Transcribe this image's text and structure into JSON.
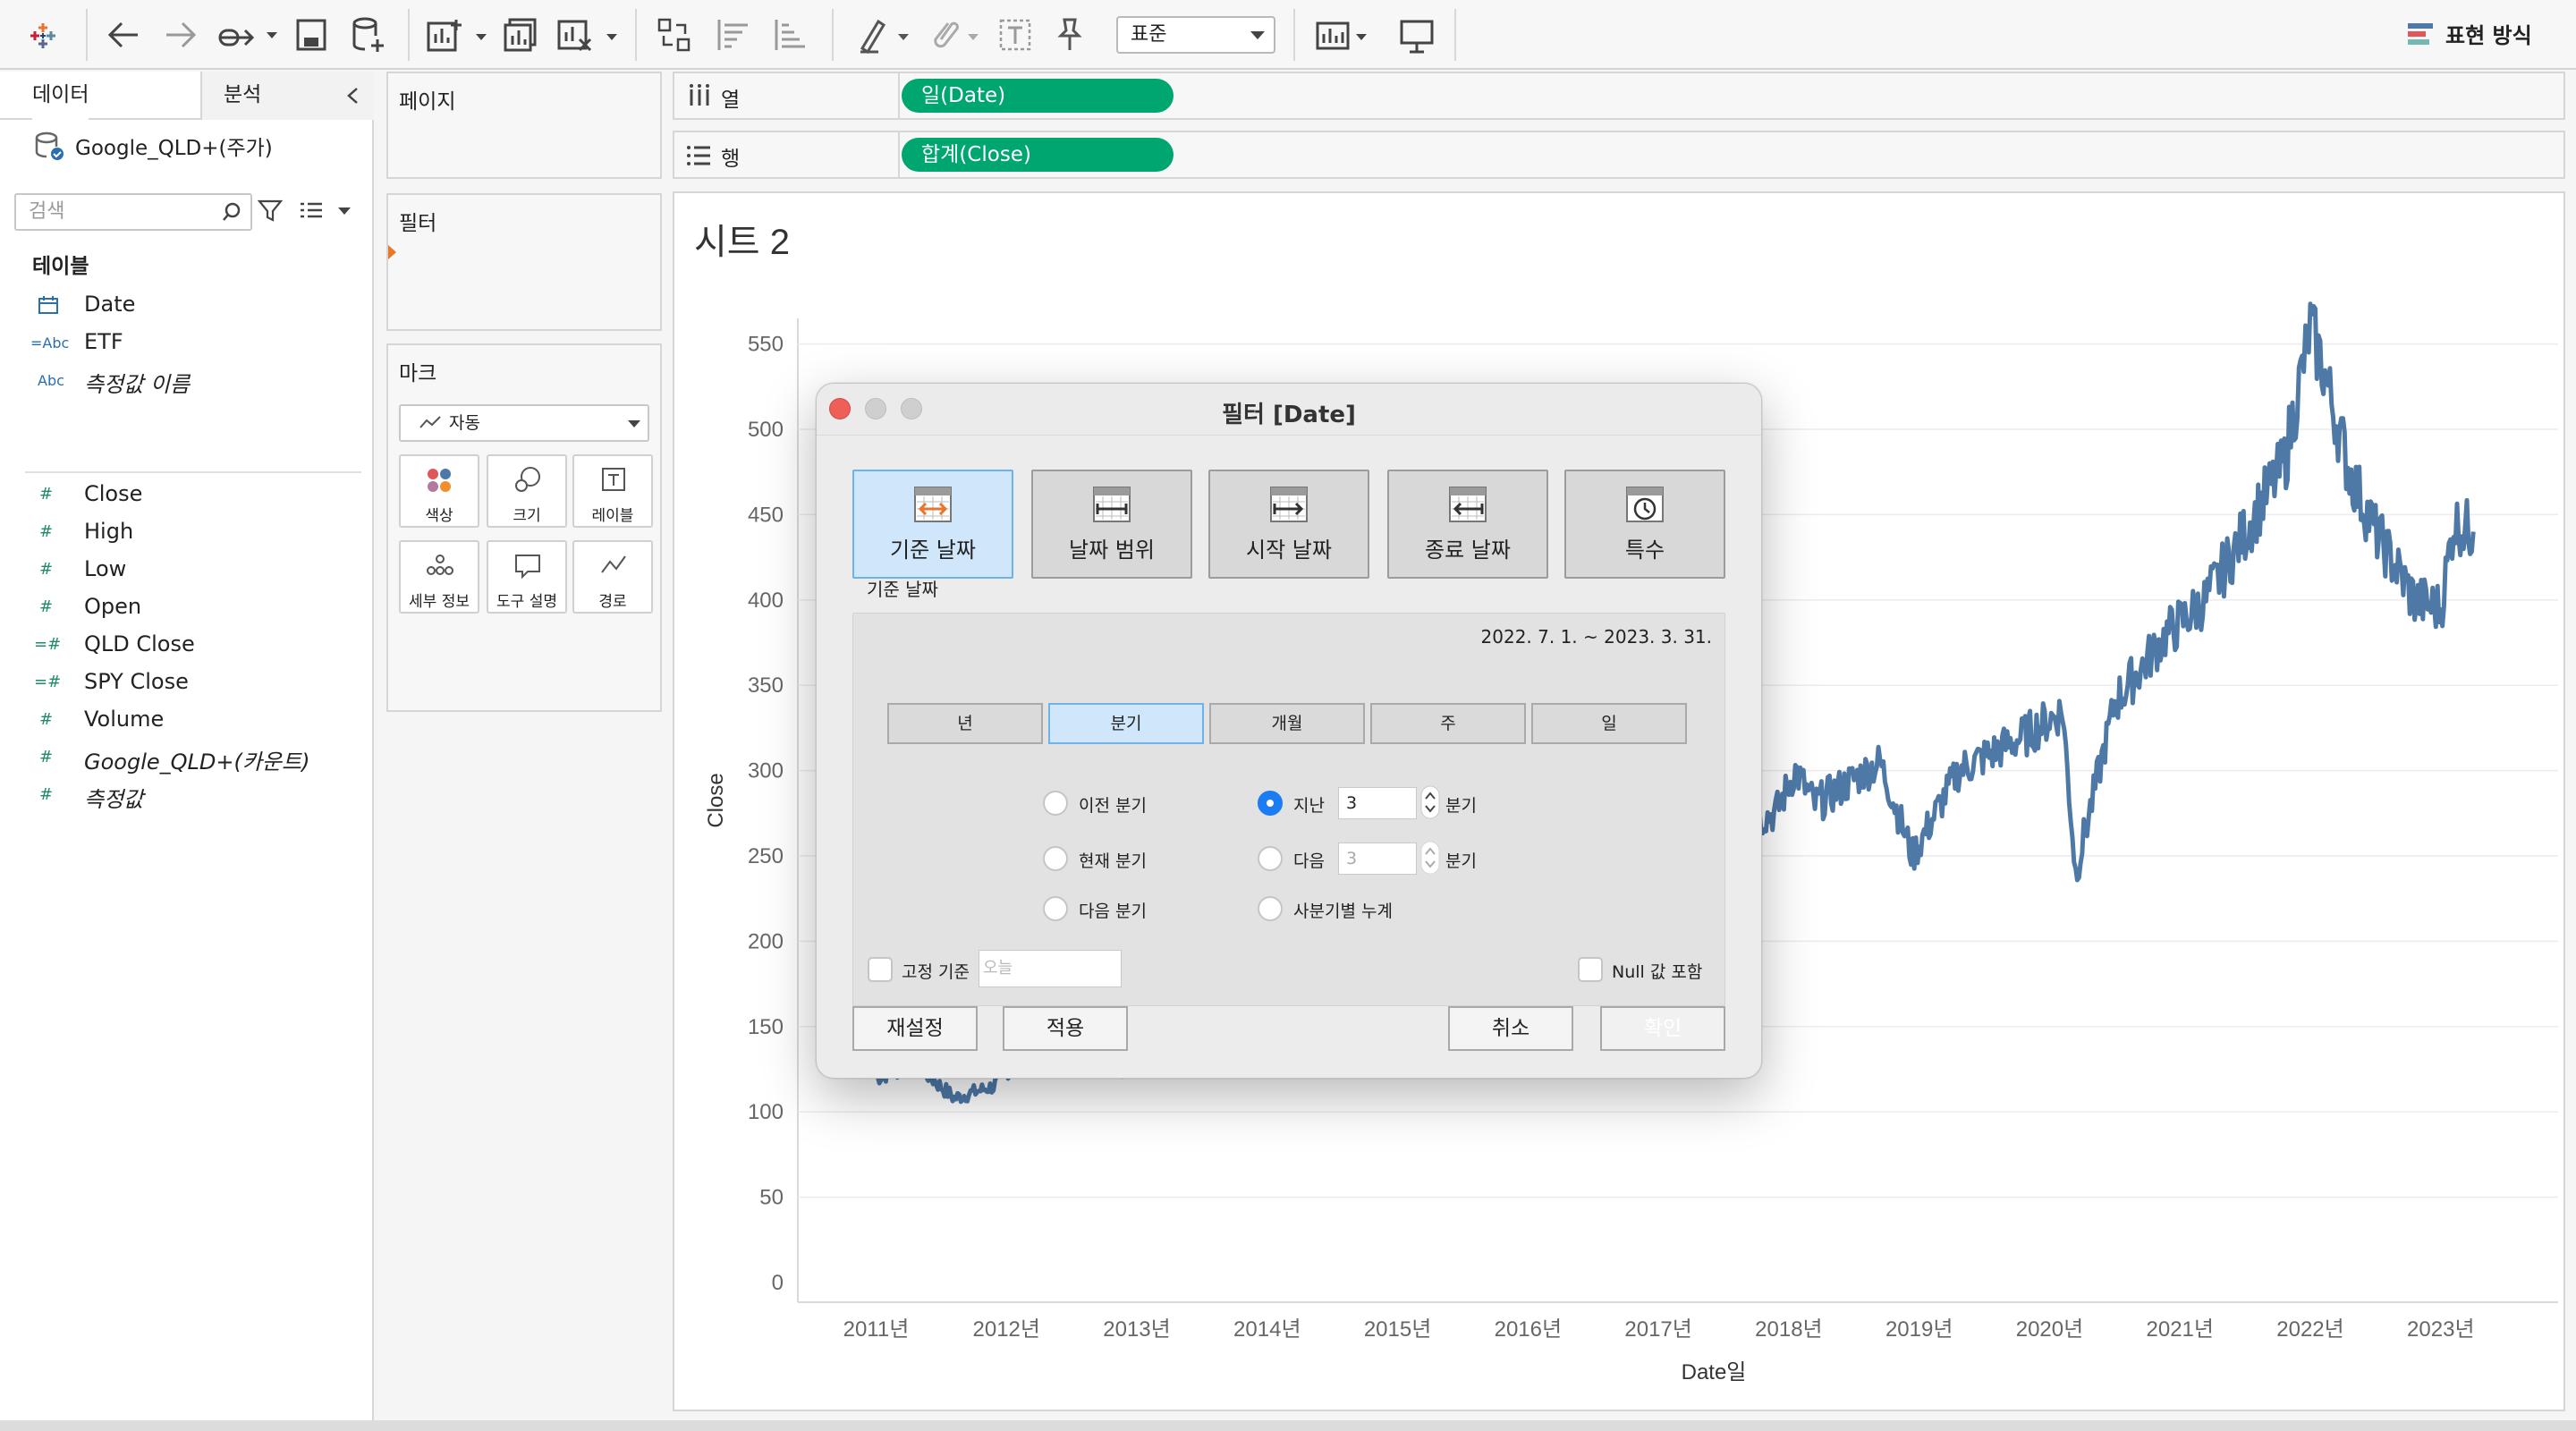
{
  "toolbar": {
    "view_select": "표준",
    "show_me": "표현 방식"
  },
  "left_pane": {
    "tab_data": "데이터",
    "tab_analytics": "분석",
    "datasource": "Google_QLD+(주가)",
    "search_placeholder": "검색",
    "section_tables": "테이블",
    "fields": [
      {
        "name": "Date",
        "kind": "date"
      },
      {
        "name": "ETF",
        "kind": "string-calc"
      },
      {
        "name": "측정값 이름",
        "kind": "string",
        "italic": true
      },
      {
        "name": "Close",
        "kind": "measure"
      },
      {
        "name": "High",
        "kind": "measure"
      },
      {
        "name": "Low",
        "kind": "measure"
      },
      {
        "name": "Open",
        "kind": "measure"
      },
      {
        "name": "QLD Close",
        "kind": "measure-calc"
      },
      {
        "name": "SPY Close",
        "kind": "measure-calc"
      },
      {
        "name": "Volume",
        "kind": "measure"
      },
      {
        "name": "Google_QLD+(카운트)",
        "kind": "measure",
        "italic": true
      },
      {
        "name": "측정값",
        "kind": "measure",
        "italic": true
      }
    ],
    "field_icons": {
      "date": "calendar-icon",
      "string-calc": "=Abc",
      "string": "Abc",
      "measure": "#",
      "measure-calc": "=#"
    }
  },
  "cards": {
    "pages": "페이지",
    "filters": "필터",
    "marks": "마크",
    "marks_type": "자동",
    "mark_buttons": [
      {
        "label": "색상",
        "icon": "color-icon"
      },
      {
        "label": "크기",
        "icon": "size-icon"
      },
      {
        "label": "레이블",
        "icon": "label-icon"
      },
      {
        "label": "세부 정보",
        "icon": "detail-icon"
      },
      {
        "label": "도구 설명",
        "icon": "tooltip-icon"
      },
      {
        "label": "경로",
        "icon": "path-icon"
      }
    ]
  },
  "shelves": {
    "columns_label": "열",
    "columns_pill": "일(Date)",
    "rows_label": "행",
    "rows_pill": "합계(Close)",
    "pill_color": "#00a66f"
  },
  "sheet": {
    "title": "시트 2"
  },
  "chart_data": {
    "type": "line",
    "xlabel": "Date일",
    "ylabel": "Close",
    "x_ticks": [
      "2011년",
      "2012년",
      "2013년",
      "2014년",
      "2015년",
      "2016년",
      "2017년",
      "2018년",
      "2019년",
      "2020년",
      "2021년",
      "2022년",
      "2023년"
    ],
    "y_ticks": [
      0,
      50,
      100,
      150,
      200,
      250,
      300,
      350,
      400,
      450,
      500,
      550
    ],
    "ylim": [
      0,
      565
    ],
    "grid": true,
    "line_color": "#4e79a7",
    "series": [
      {
        "values_by_year": [
          [
            2011.0,
            120
          ],
          [
            2011.3,
            128
          ],
          [
            2011.6,
            108
          ],
          [
            2011.9,
            115
          ],
          [
            2012.2,
            140
          ],
          [
            2012.5,
            128
          ],
          [
            2012.9,
            125
          ],
          [
            2013.3,
            150
          ],
          [
            2013.9,
            185
          ],
          [
            2014.5,
            210
          ],
          [
            2015.0,
            225
          ],
          [
            2015.5,
            240
          ],
          [
            2016.0,
            220
          ],
          [
            2016.5,
            235
          ],
          [
            2017.0,
            255
          ],
          [
            2017.6,
            268
          ],
          [
            2017.9,
            275
          ],
          [
            2018.05,
            300
          ],
          [
            2018.2,
            280
          ],
          [
            2018.7,
            305
          ],
          [
            2018.95,
            250
          ],
          [
            2019.3,
            300
          ],
          [
            2019.8,
            320
          ],
          [
            2020.1,
            335
          ],
          [
            2020.2,
            240
          ],
          [
            2020.5,
            340
          ],
          [
            2020.9,
            380
          ],
          [
            2021.2,
            400
          ],
          [
            2021.5,
            440
          ],
          [
            2021.8,
            480
          ],
          [
            2022.0,
            560
          ],
          [
            2022.1,
            535
          ],
          [
            2022.3,
            475
          ],
          [
            2022.5,
            440
          ],
          [
            2022.8,
            400
          ],
          [
            2023.0,
            395
          ],
          [
            2023.1,
            445
          ],
          [
            2023.25,
            440
          ]
        ]
      }
    ]
  },
  "dialog": {
    "title": "필터 [Date]",
    "modes": [
      {
        "label": "기준 날짜",
        "selected": true
      },
      {
        "label": "날짜 범위",
        "selected": false
      },
      {
        "label": "시작 날짜",
        "selected": false
      },
      {
        "label": "종료 날짜",
        "selected": false
      },
      {
        "label": "특수",
        "selected": false
      }
    ],
    "subtitle": "기준 날짜",
    "date_range": "2022. 7. 1. ~ 2023. 3. 31.",
    "units": [
      {
        "label": "년",
        "selected": false
      },
      {
        "label": "분기",
        "selected": true
      },
      {
        "label": "개월",
        "selected": false
      },
      {
        "label": "주",
        "selected": false
      },
      {
        "label": "일",
        "selected": false
      }
    ],
    "radio_prev": "이전 분기",
    "radio_current": "현재 분기",
    "radio_next_unit": "다음 분기",
    "radio_last": "지난",
    "last_value": "3",
    "last_unit": "분기",
    "radio_next": "다음",
    "next_value": "3",
    "next_unit": "분기",
    "radio_qtd": "사분기별 누계",
    "fixed_label": "고정 기준",
    "fixed_placeholder": "오늘",
    "null_label": "Null 값 포함",
    "btn_reset": "재설정",
    "btn_apply": "적용",
    "btn_cancel": "취소",
    "btn_ok": "확인"
  }
}
